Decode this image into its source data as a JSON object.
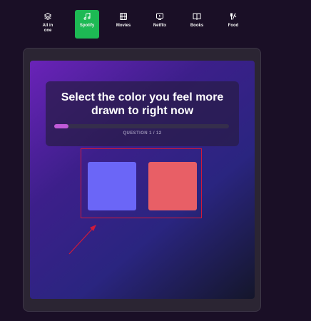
{
  "nav": {
    "items": [
      {
        "label": "All in one",
        "icon": "layers-icon"
      },
      {
        "label": "Spotify",
        "icon": "music-note-icon",
        "active": true
      },
      {
        "label": "Movies",
        "icon": "film-icon"
      },
      {
        "label": "Netflix",
        "icon": "tv-icon"
      },
      {
        "label": "Books",
        "icon": "book-icon"
      },
      {
        "label": "Food",
        "icon": "utensils-icon"
      }
    ],
    "active_color": "#1db954"
  },
  "quiz": {
    "question": "Select the color you feel more drawn to right now",
    "progress_label": "QUESTION 1 / 12",
    "current": 1,
    "total": 12,
    "options": [
      {
        "color": "#6b66f7"
      },
      {
        "color": "#e85f66"
      }
    ]
  },
  "annotation": {
    "color": "#d01a3a"
  }
}
